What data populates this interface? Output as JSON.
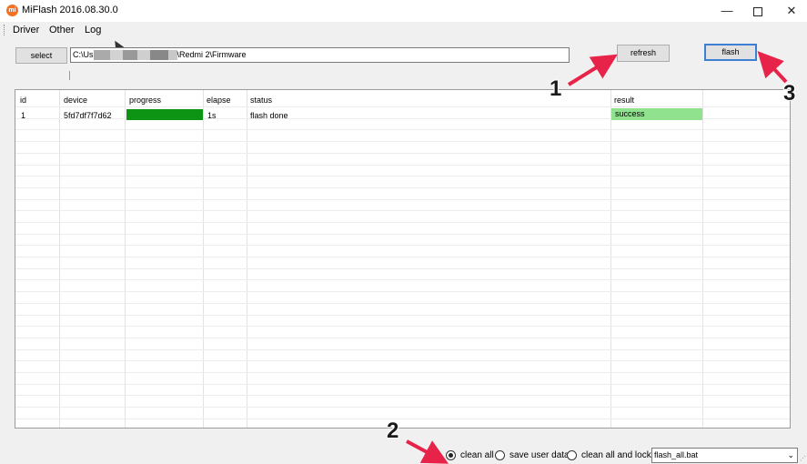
{
  "window": {
    "title": "MiFlash 2016.08.30.0",
    "app_icon_text": "mi",
    "controls": {
      "minimize": "—",
      "close": "✕"
    }
  },
  "menu": {
    "items": [
      "Driver",
      "Other",
      "Log"
    ]
  },
  "toolbar": {
    "select_label": "select",
    "path_prefix": "C:\\Us",
    "path_suffix": "\\Redmi 2\\Firmware",
    "refresh_label": "refresh",
    "flash_label": "flash"
  },
  "table": {
    "columns": [
      "id",
      "device",
      "progress",
      "elapse",
      "status",
      "result"
    ],
    "rows": [
      {
        "id": "1",
        "device": "5fd7df7f7d62",
        "progress": 1.0,
        "elapse": "1s",
        "status": "flash done",
        "result": "success"
      }
    ]
  },
  "options": {
    "radios": [
      {
        "label": "clean all",
        "selected": true
      },
      {
        "label": "save user data",
        "selected": false
      },
      {
        "label": "clean all and lock",
        "selected": false
      }
    ],
    "script_select": "flash_all.bat"
  },
  "callouts": [
    "1",
    "2",
    "3"
  ],
  "colors": {
    "progress_fill": "#0d9415",
    "result_success": "#90e28f",
    "annotation_arrow": "#e8234a",
    "flash_button_focus": "#3c7fd3"
  },
  "icons": {
    "app": "xiaomi-logo-icon",
    "dropdown": "chevron-down-icon",
    "resize": "resize-grip-icon"
  }
}
